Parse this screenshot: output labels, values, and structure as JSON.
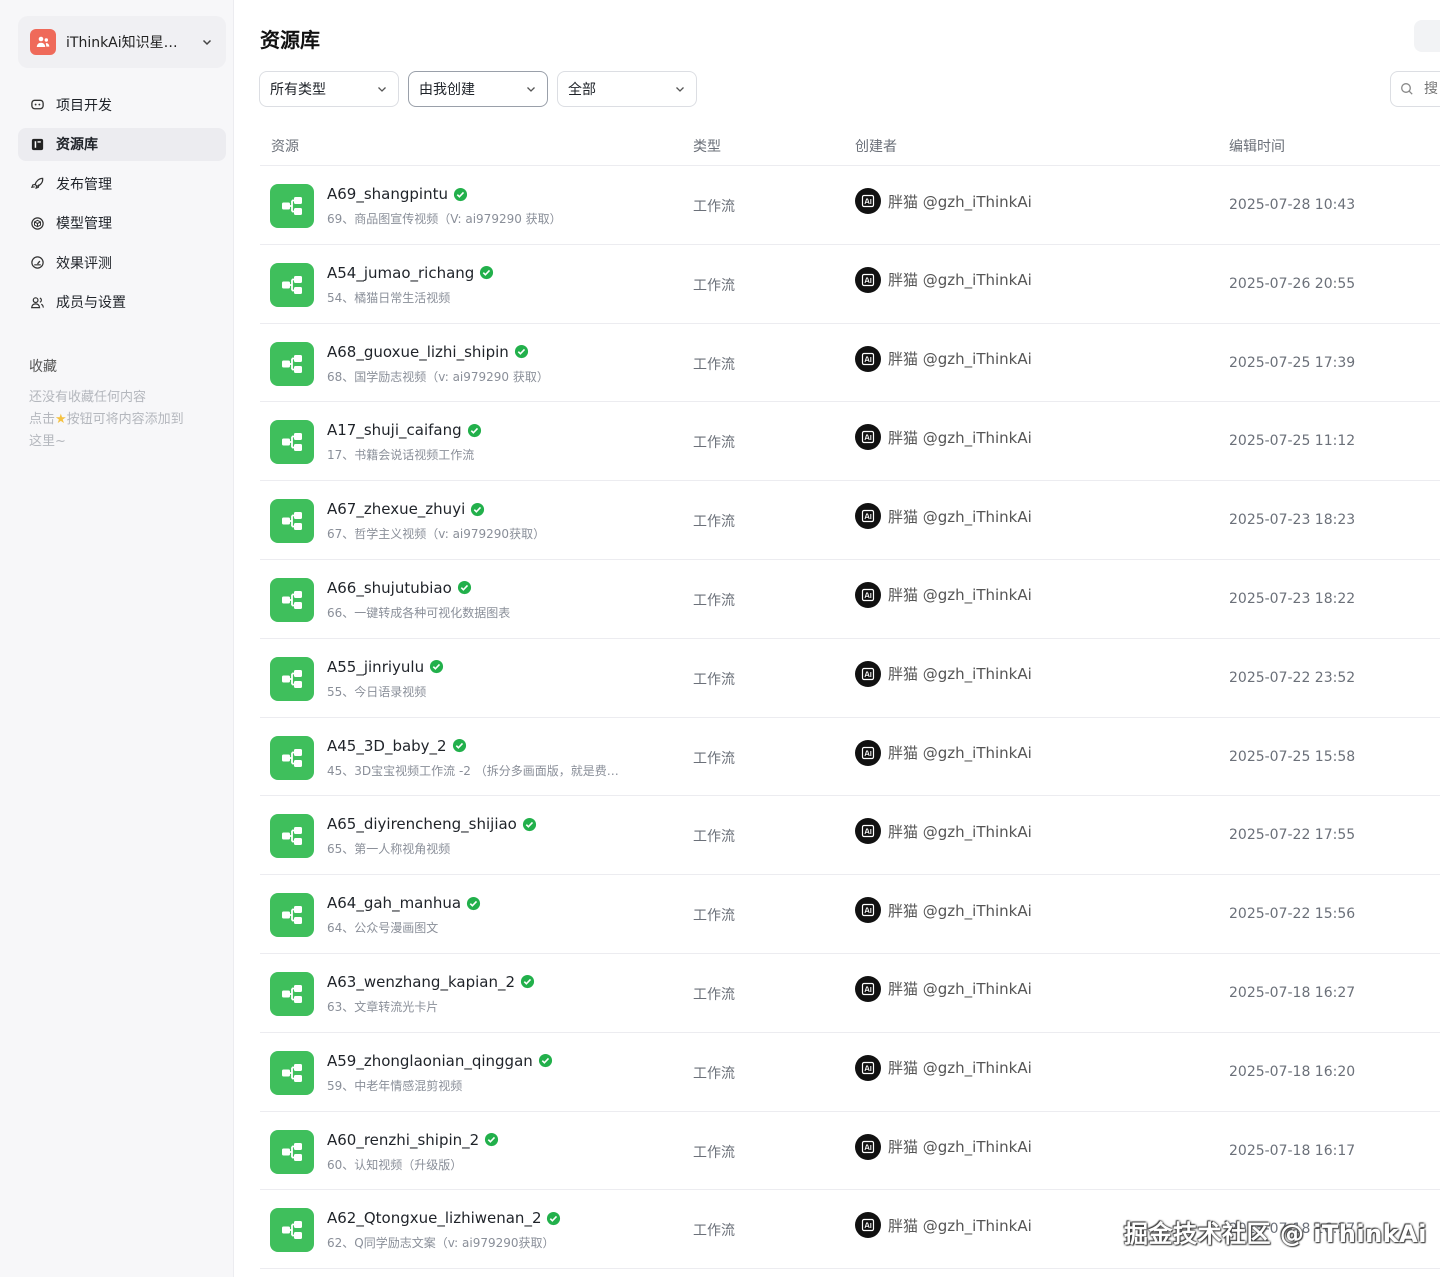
{
  "workspace": {
    "name": "iThinkAi知识星…"
  },
  "nav": [
    {
      "label": "项目开发",
      "icon": "bot-icon",
      "active": false
    },
    {
      "label": "资源库",
      "icon": "library-icon",
      "active": true
    },
    {
      "label": "发布管理",
      "icon": "rocket-icon",
      "active": false
    },
    {
      "label": "模型管理",
      "icon": "model-cube-icon",
      "active": false
    },
    {
      "label": "效果评测",
      "icon": "gauge-icon",
      "active": false
    },
    {
      "label": "成员与设置",
      "icon": "members-icon",
      "active": false
    }
  ],
  "favorites": {
    "title": "收藏",
    "empty_line1": "还没有收藏任何内容",
    "empty_line2_pre": "点击",
    "empty_line2_post": "按钮可将内容添加到",
    "empty_line3": "这里~"
  },
  "page": {
    "title": "资源库"
  },
  "filters": {
    "type": "所有类型",
    "creator": "由我创建",
    "status": "全部"
  },
  "search": {
    "placeholder": "搜"
  },
  "table": {
    "headers": {
      "resource": "资源",
      "type": "类型",
      "creator": "创建者",
      "edited": "编辑时间"
    },
    "rows": [
      {
        "name": "A69_shangpintu",
        "desc": "69、商品图宣传视频（V:   ai979290 获取）",
        "type": "工作流",
        "creator": "胖猫 @gzh_iThinkAi",
        "time": "2025-07-28 10:43"
      },
      {
        "name": "A54_jumao_richang",
        "desc": "54、橘猫日常生活视频",
        "type": "工作流",
        "creator": "胖猫 @gzh_iThinkAi",
        "time": "2025-07-26 20:55"
      },
      {
        "name": "A68_guoxue_lizhi_shipin",
        "desc": "68、国学励志视频（v: ai979290 获取）",
        "type": "工作流",
        "creator": "胖猫 @gzh_iThinkAi",
        "time": "2025-07-25 17:39"
      },
      {
        "name": "A17_shuji_caifang",
        "desc": "17、书籍会说话视频工作流",
        "type": "工作流",
        "creator": "胖猫 @gzh_iThinkAi",
        "time": "2025-07-25 11:12"
      },
      {
        "name": "A67_zhexue_zhuyi",
        "desc": "67、哲学主义视频（v:  ai979290获取）",
        "type": "工作流",
        "creator": "胖猫 @gzh_iThinkAi",
        "time": "2025-07-23 18:23"
      },
      {
        "name": "A66_shujutubiao",
        "desc": "66、一键转成各种可视化数据图表",
        "type": "工作流",
        "creator": "胖猫 @gzh_iThinkAi",
        "time": "2025-07-23 18:22"
      },
      {
        "name": "A55_jinriyulu",
        "desc": "55、今日语录视频",
        "type": "工作流",
        "creator": "胖猫 @gzh_iThinkAi",
        "time": "2025-07-22 23:52"
      },
      {
        "name": "A45_3D_baby_2",
        "desc": "45、3D宝宝视频工作流 -2 （拆分多画面版，就是费…",
        "type": "工作流",
        "creator": "胖猫 @gzh_iThinkAi",
        "time": "2025-07-25 15:58"
      },
      {
        "name": "A65_diyirencheng_shijiao",
        "desc": "65、第一人称视角视频",
        "type": "工作流",
        "creator": "胖猫 @gzh_iThinkAi",
        "time": "2025-07-22 17:55"
      },
      {
        "name": "A64_gah_manhua",
        "desc": "64、公众号漫画图文",
        "type": "工作流",
        "creator": "胖猫 @gzh_iThinkAi",
        "time": "2025-07-22 15:56"
      },
      {
        "name": "A63_wenzhang_kapian_2",
        "desc": "63、文章转流光卡片",
        "type": "工作流",
        "creator": "胖猫 @gzh_iThinkAi",
        "time": "2025-07-18 16:27"
      },
      {
        "name": "A59_zhonglaonian_qinggan",
        "desc": "59、中老年情感混剪视频",
        "type": "工作流",
        "creator": "胖猫 @gzh_iThinkAi",
        "time": "2025-07-18 16:20"
      },
      {
        "name": "A60_renzhi_shipin_2",
        "desc": "60、认知视频（升级版）",
        "type": "工作流",
        "creator": "胖猫 @gzh_iThinkAi",
        "time": "2025-07-18 16:17"
      },
      {
        "name": "A62_Qtongxue_lizhiwenan_2",
        "desc": "62、Q同学励志文案（v:  ai979290获取）",
        "type": "工作流",
        "creator": "胖猫 @gzh_iThinkAi",
        "time": "2025-07-18 16:17"
      }
    ]
  },
  "watermark": "掘金技术社区 @ iThinkAi",
  "colors": {
    "workflow_green": "#3fbf5c",
    "verified_green": "#22b04b",
    "workspace_red": "#ef6a5a"
  }
}
